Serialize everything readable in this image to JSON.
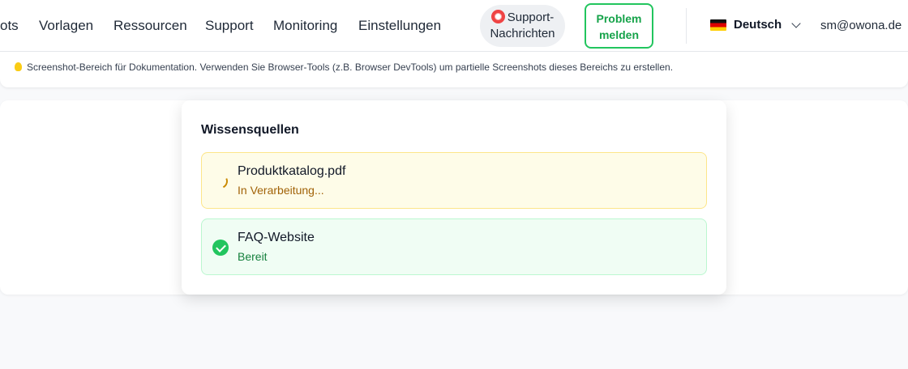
{
  "nav": {
    "items": [
      "ots",
      "Vorlagen",
      "Ressourcen",
      "Support",
      "Monitoring",
      "Einstellungen"
    ],
    "support_messages_line1": "Support-",
    "support_messages_line2": "Nachrichten",
    "report_problem_line1": "Problem",
    "report_problem_line2": "melden",
    "language": "Deutsch",
    "user_email": "sm@owona.de"
  },
  "doc_panel": {
    "note": "Screenshot-Bereich für Dokumentation. Verwenden Sie Browser-Tools (z.B. Browser DevTools) um partielle Screenshots dieses Bereichs zu erstellen."
  },
  "knowledge": {
    "title": "Wissensquellen",
    "sources": [
      {
        "name": "Produktkatalog.pdf",
        "status": "In Verarbeitung...",
        "state": "processing",
        "icon": "spinner-icon"
      },
      {
        "name": "FAQ-Website",
        "status": "Bereit",
        "state": "ready",
        "icon": "check-circle-icon"
      }
    ]
  },
  "colors": {
    "accent_green": "#22c55e",
    "processing_bg": "#fefce8",
    "ready_bg": "#f0fdf4"
  }
}
